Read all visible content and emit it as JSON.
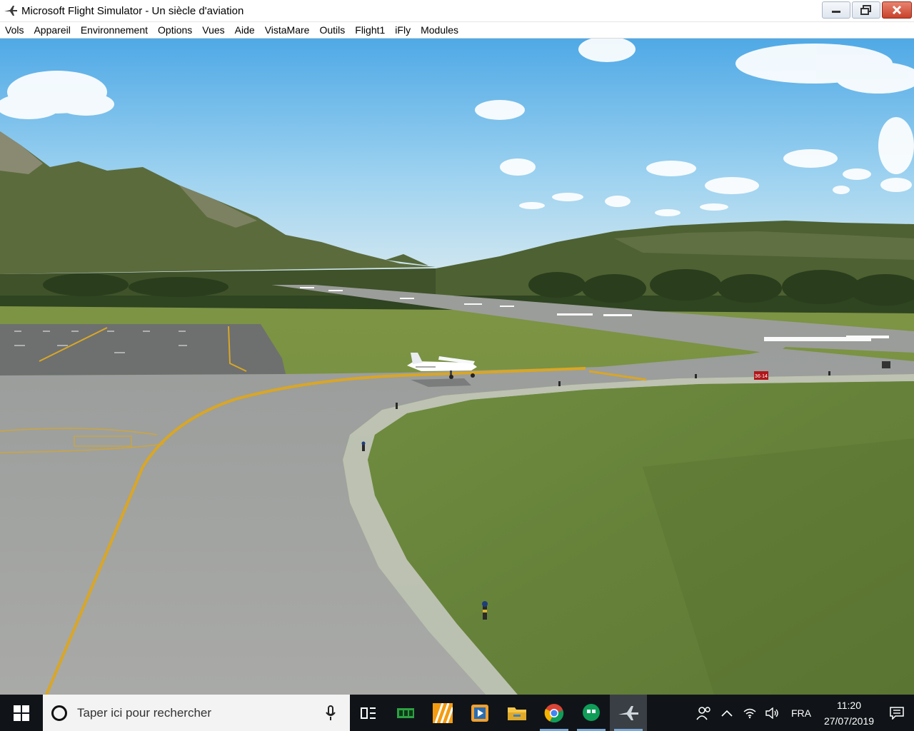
{
  "window": {
    "title": "Microsoft Flight Simulator - Un siècle d'aviation",
    "app_icon": "airplane-icon",
    "controls": [
      "minimize-icon",
      "restore-icon",
      "close-icon"
    ]
  },
  "menu": {
    "items": [
      "Vols",
      "Appareil",
      "Environnement",
      "Options",
      "Vues",
      "Aide",
      "VistaMare",
      "Outils",
      "Flight1",
      "iFly",
      "Modules"
    ]
  },
  "scene": {
    "description_icon": "flight-sim-viewport",
    "runway_sign": "36·14"
  },
  "taskbar": {
    "search_placeholder": "Taper ici pour rechercher",
    "pinned": [
      {
        "name": "task-view-icon"
      },
      {
        "name": "green-app-icon"
      },
      {
        "name": "orange-stripes-app-icon"
      },
      {
        "name": "media-player-icon"
      },
      {
        "name": "file-explorer-icon"
      },
      {
        "name": "chrome-icon"
      },
      {
        "name": "hangouts-icon"
      },
      {
        "name": "flight-sim-icon"
      }
    ],
    "tray": {
      "language": "FRA",
      "time": "11:20",
      "date": "27/07/2019"
    }
  },
  "colors": {
    "taskbar_bg": "#101418",
    "sky_top": "#5fb4ea",
    "grass": "#6e8a3e",
    "tarmac": "#a6a8a6",
    "taxi_line": "#d9a626"
  }
}
